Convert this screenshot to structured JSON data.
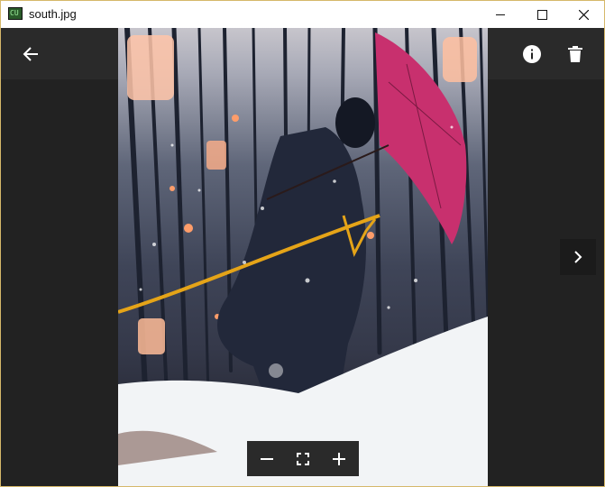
{
  "window": {
    "title": "south.jpg",
    "app_icon_text": "CU",
    "controls": [
      "minimize-icon",
      "maximize-icon",
      "close-icon"
    ]
  },
  "toolbar": {
    "left_icons": [
      "arrow-left-icon"
    ],
    "right_icons": [
      "info-icon",
      "trash-icon"
    ]
  },
  "navigation": {
    "next_icon": "chevron-right-icon"
  },
  "zoom_controls": {
    "icons": [
      "minus-icon",
      "fullscreen-icon",
      "plus-icon"
    ]
  },
  "colors": {
    "viewer_bg": "#222222",
    "topbar_bg": "#2a2a2a",
    "umbrella": "#c8306e",
    "ribbon": "#e5a418"
  }
}
